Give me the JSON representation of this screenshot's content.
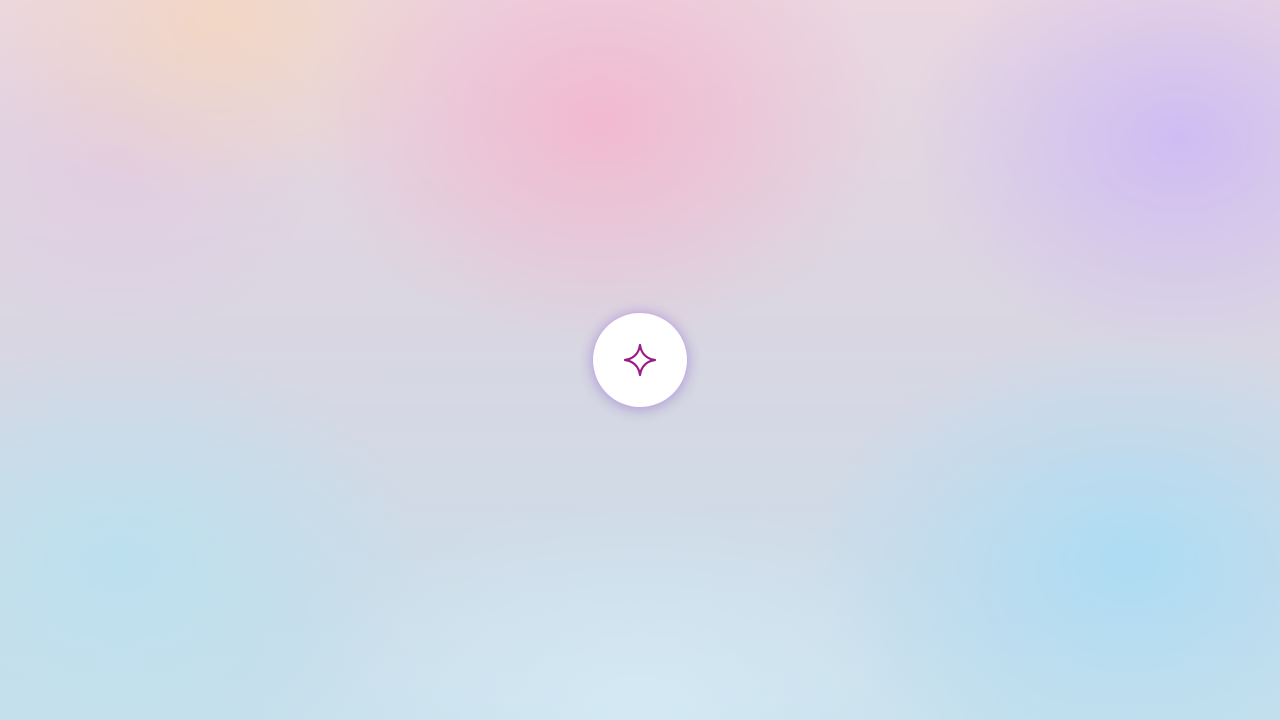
{
  "background": {
    "description_colors": [
      "#f4b4cd",
      "#cdb9f5",
      "#f5d7be",
      "#aadcf5",
      "#b9e1f0"
    ]
  },
  "assistant_button": {
    "icon": "sparkle-icon",
    "icon_color": "#9a1a86",
    "background_color": "#ffffff"
  }
}
